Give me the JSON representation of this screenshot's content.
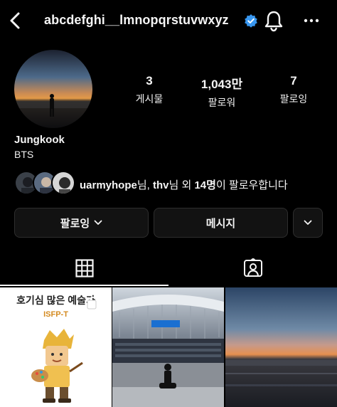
{
  "header": {
    "username": "abcdefghi__lmnopqrstuvwxyz",
    "icons": [
      "back-arrow-icon",
      "verified-badge-icon",
      "bell-icon",
      "more-options-icon"
    ]
  },
  "profile": {
    "name": "Jungkook",
    "bio": "BTS",
    "stats": [
      {
        "value": "3",
        "label": "게시물"
      },
      {
        "value": "1,043만",
        "label": "팔로워"
      },
      {
        "value": "7",
        "label": "팔로잉"
      }
    ]
  },
  "followed_by": {
    "user1": "uarmyhope",
    "sep1": "님, ",
    "user2": "thv",
    "sep2": "님 외 ",
    "count": "14명",
    "suffix": "이 팔로우합니다"
  },
  "buttons": {
    "following": "팔로잉",
    "message": "메시지"
  },
  "tabs": [
    "grid-icon",
    "tagged-icon"
  ],
  "posts": [
    {
      "title": "호기심 많은 예술가",
      "subtitle": "ISFP-T"
    },
    {},
    {}
  ],
  "colors": {
    "background": "#000000",
    "button_bg": "#121212",
    "verified": "#3897f0"
  }
}
